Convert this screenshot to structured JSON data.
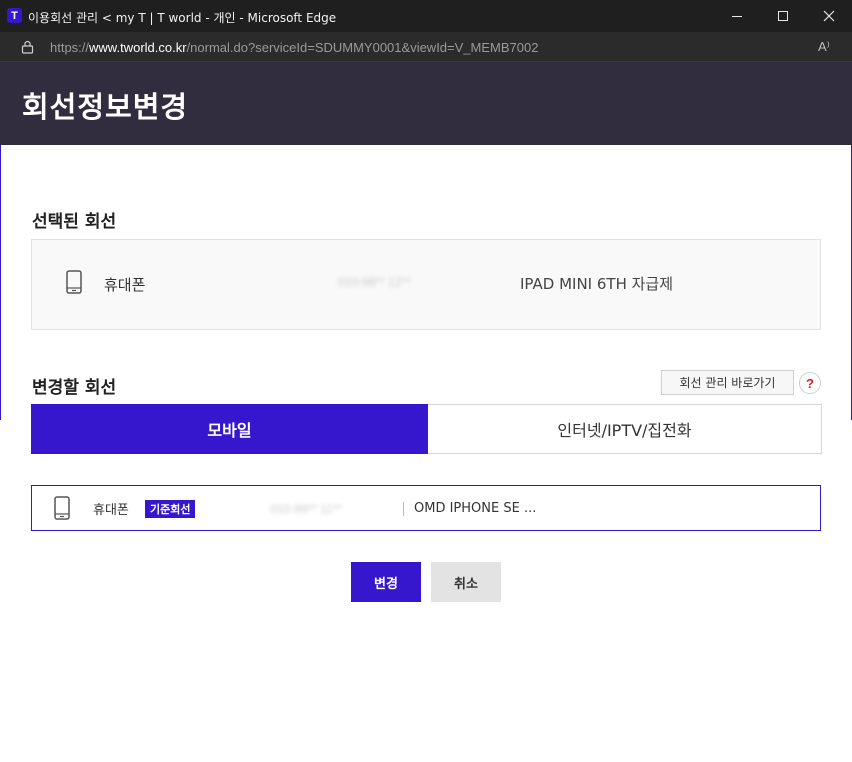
{
  "browser": {
    "window_title": "이용회선 관리 < my T | T world - 개인 - Microsoft Edge",
    "app_icon_letter": "T",
    "url_prefix": "https://",
    "url_host": "www.tworld.co.kr",
    "url_path": "/normal.do?serviceId=SDUMMY0001&viewId=V_MEMB7002",
    "read_aloud_glyph": "A⁾",
    "icons": [
      "tworld-app-icon",
      "minimize-icon",
      "maximize-icon",
      "close-icon",
      "lock-icon",
      "read-aloud-icon"
    ]
  },
  "page": {
    "title": "회선정보변경"
  },
  "selected_line": {
    "section_title": "선택된 회선",
    "device": "휴대폰",
    "number_masked": "010-98** 12**",
    "plan": "IPAD MINI 6TH 자급제"
  },
  "change_line": {
    "section_title": "변경할 회선",
    "shortcut_button": "회선 관리 바로가기",
    "help_glyph": "?",
    "tabs": [
      {
        "label": "모바일",
        "active": true
      },
      {
        "label": "인터넷/IPTV/집전화",
        "active": false
      }
    ],
    "item": {
      "device": "휴대폰",
      "badge": "기준회선",
      "number_masked": "010-99** 11**",
      "plan": "OMD IPHONE SE ..."
    }
  },
  "actions": {
    "change": "변경",
    "cancel": "취소"
  },
  "colors": {
    "brand": "#3617cd",
    "header_bg": "#312d3f",
    "help": "#d0212e"
  }
}
